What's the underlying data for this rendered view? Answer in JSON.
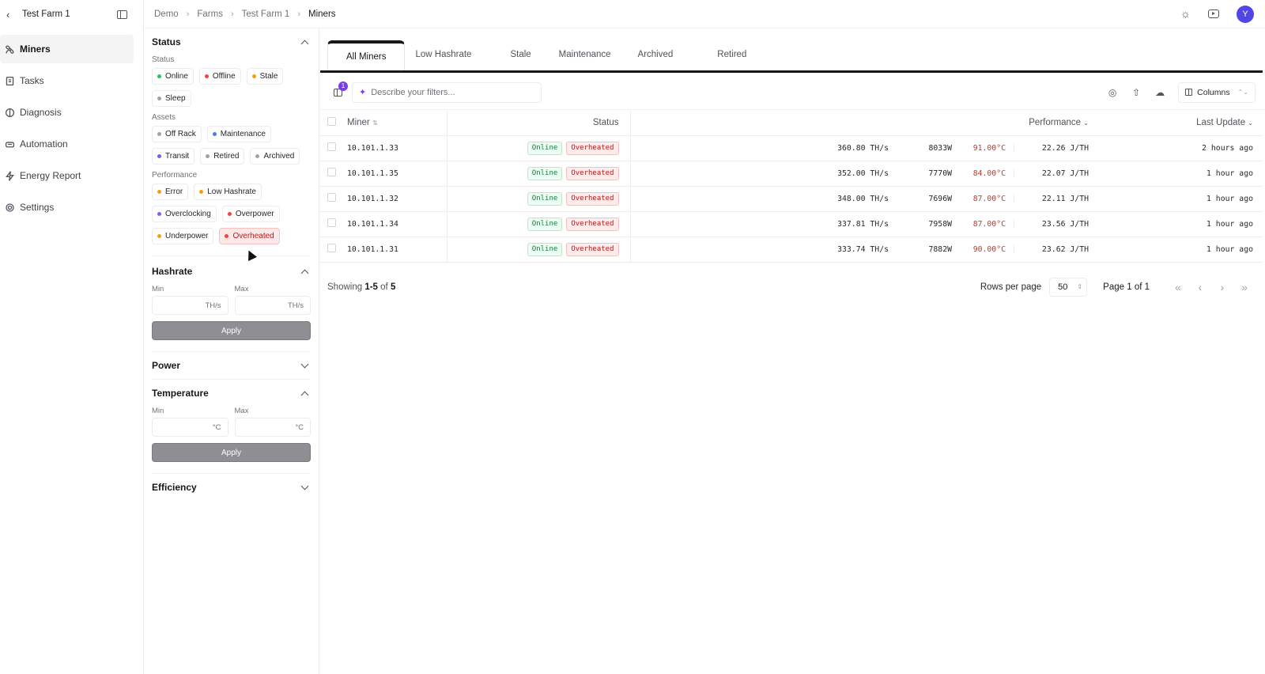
{
  "nav": {
    "farm_title": "Test Farm 1",
    "items": [
      {
        "label": "Miners",
        "active": true
      },
      {
        "label": "Tasks",
        "active": false
      },
      {
        "label": "Diagnosis",
        "active": false
      },
      {
        "label": "Automation",
        "active": false
      },
      {
        "label": "Energy Report",
        "active": false
      },
      {
        "label": "Settings",
        "active": false
      }
    ]
  },
  "header": {
    "breadcrumb": [
      "Demo",
      "Farms",
      "Test Farm 1",
      "Miners"
    ],
    "avatar_initial": "Y"
  },
  "filters": {
    "status": {
      "title": "Status",
      "sub": "Status",
      "chips": [
        {
          "label": "Online",
          "color": "#22c55e"
        },
        {
          "label": "Offline",
          "color": "#ef4444"
        },
        {
          "label": "Stale",
          "color": "#f59e0b"
        },
        {
          "label": "Sleep",
          "color": "#a1a1aa"
        }
      ],
      "assets_sub": "Assets",
      "assets": [
        {
          "label": "Off Rack",
          "color": "#a1a1aa"
        },
        {
          "label": "Maintenance",
          "color": "#3b82f6"
        },
        {
          "label": "Transit",
          "color": "#6366f1"
        },
        {
          "label": "Retired",
          "color": "#a1a1aa"
        },
        {
          "label": "Archived",
          "color": "#a1a1aa"
        }
      ],
      "perf_sub": "Performance",
      "performance": [
        {
          "label": "Error",
          "color": "#f59e0b",
          "selected": false
        },
        {
          "label": "Low Hashrate",
          "color": "#f59e0b",
          "selected": false
        },
        {
          "label": "Overclocking",
          "color": "#8b5cf6",
          "selected": false
        },
        {
          "label": "Overpower",
          "color": "#ef4444",
          "selected": false
        },
        {
          "label": "Underpower",
          "color": "#f59e0b",
          "selected": false
        },
        {
          "label": "Overheated",
          "color": "#ef4444",
          "selected": true
        }
      ]
    },
    "hashrate": {
      "title": "Hashrate",
      "min_label": "Min",
      "max_label": "Max",
      "unit": "TH/s",
      "apply": "Apply"
    },
    "power": {
      "title": "Power"
    },
    "temperature": {
      "title": "Temperature",
      "min_label": "Min",
      "max_label": "Max",
      "unit": "°C",
      "apply": "Apply"
    },
    "efficiency": {
      "title": "Efficiency"
    }
  },
  "tabs": [
    "All Miners",
    "Low Hashrate",
    "Stale",
    "Maintenance",
    "Archived",
    "Retired"
  ],
  "toolbar": {
    "filter_count": "1",
    "search_placeholder": "Describe your filters...",
    "columns_label": "Columns"
  },
  "table": {
    "headers": {
      "miner": "Miner",
      "status": "Status",
      "performance": "Performance",
      "last_update": "Last Update"
    },
    "rows": [
      {
        "ip": "10.101.1.33",
        "status": "Online",
        "flag": "Overheated",
        "hashrate": "360.80 TH/s",
        "power": "8033W",
        "temp": "91.00°C",
        "eff": "22.26 J/TH",
        "updated": "2 hours ago"
      },
      {
        "ip": "10.101.1.35",
        "status": "Online",
        "flag": "Overheated",
        "hashrate": "352.00 TH/s",
        "power": "7770W",
        "temp": "84.00°C",
        "eff": "22.07 J/TH",
        "updated": "1 hour ago"
      },
      {
        "ip": "10.101.1.32",
        "status": "Online",
        "flag": "Overheated",
        "hashrate": "348.00 TH/s",
        "power": "7696W",
        "temp": "87.00°C",
        "eff": "22.11 J/TH",
        "updated": "1 hour ago"
      },
      {
        "ip": "10.101.1.34",
        "status": "Online",
        "flag": "Overheated",
        "hashrate": "337.81 TH/s",
        "power": "7958W",
        "temp": "87.00°C",
        "eff": "23.56 J/TH",
        "updated": "1 hour ago"
      },
      {
        "ip": "10.101.1.31",
        "status": "Online",
        "flag": "Overheated",
        "hashrate": "333.74 TH/s",
        "power": "7882W",
        "temp": "90.00°C",
        "eff": "23.62 J/TH",
        "updated": "1 hour ago"
      }
    ]
  },
  "pager": {
    "showing_prefix": "Showing",
    "range": "1-5",
    "of": "of",
    "total": "5",
    "rows_per_page_label": "Rows per page",
    "rows_per_page": "50",
    "page_info": "Page 1 of 1"
  }
}
